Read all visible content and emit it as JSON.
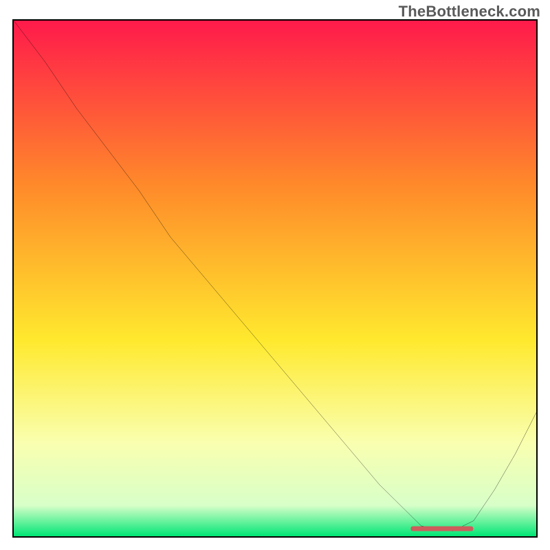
{
  "watermark": "TheBottleneck.com",
  "colors": {
    "top": "#ff1a4b",
    "upper_mid": "#ff8a2a",
    "mid": "#ffe92e",
    "lower_mid": "#f9ffb0",
    "bottom_pale": "#d8ffc8",
    "bottom": "#00e676",
    "curve": "#000000",
    "marker": "#cd5c5c",
    "border": "#000000"
  },
  "chart_data": {
    "type": "line",
    "title": "",
    "xlabel": "",
    "ylabel": "",
    "xlim": [
      0,
      100
    ],
    "ylim": [
      0,
      100
    ],
    "series": [
      {
        "name": "bottleneck-curve",
        "x": [
          0,
          6,
          12,
          18,
          24,
          30,
          40,
          50,
          60,
          70,
          78,
          84,
          88,
          92,
          96,
          100
        ],
        "y": [
          100,
          92,
          83,
          75,
          67,
          58,
          46,
          34,
          22,
          10,
          2,
          1,
          3,
          9,
          16,
          24
        ]
      }
    ],
    "annotations": [
      {
        "name": "sweet-spot-marker",
        "x": 82,
        "y": 1.5,
        "width_pct": 12
      }
    ],
    "gradient_stops": [
      {
        "pct": 0,
        "color": "#ff1a4b"
      },
      {
        "pct": 32,
        "color": "#ff8a2a"
      },
      {
        "pct": 62,
        "color": "#ffe92e"
      },
      {
        "pct": 82,
        "color": "#f9ffb0"
      },
      {
        "pct": 94,
        "color": "#d8ffc8"
      },
      {
        "pct": 100,
        "color": "#00e676"
      }
    ]
  }
}
